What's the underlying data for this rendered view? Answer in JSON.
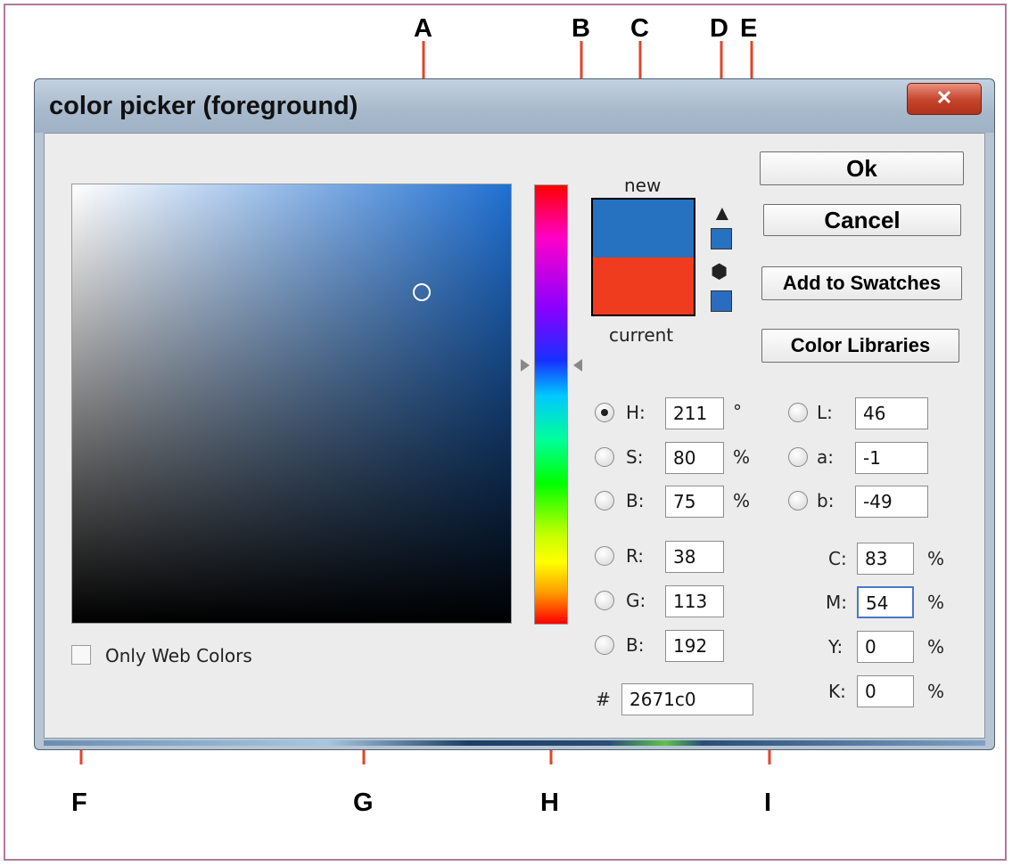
{
  "callouts": [
    "A",
    "B",
    "C",
    "D",
    "E",
    "F",
    "G",
    "H",
    "I"
  ],
  "dialog": {
    "title": "color picker (foreground)",
    "close_glyph": "✕"
  },
  "swatch": {
    "new_label": "new",
    "current_label": "current",
    "new_color": "#2671c0",
    "current_color": "#ef3c1e"
  },
  "buttons": {
    "ok": "Ok",
    "cancel": "Cancel",
    "add_to_swatches": "Add to Swatches",
    "color_libraries": "Color Libraries"
  },
  "hsb": [
    {
      "label": "H:",
      "value": "211",
      "unit": "°",
      "selected": true
    },
    {
      "label": "S:",
      "value": "80",
      "unit": "%",
      "selected": false
    },
    {
      "label": "B:",
      "value": "75",
      "unit": "%",
      "selected": false
    }
  ],
  "rgb": [
    {
      "label": "R:",
      "value": "38"
    },
    {
      "label": "G:",
      "value": "113"
    },
    {
      "label": "B:",
      "value": "192"
    }
  ],
  "lab": [
    {
      "label": "L:",
      "value": "46"
    },
    {
      "label": "a:",
      "value": "-1"
    },
    {
      "label": "b:",
      "value": "-49"
    }
  ],
  "cmyk": [
    {
      "label": "C:",
      "value": "83",
      "unit": "%"
    },
    {
      "label": "M:",
      "value": "54",
      "unit": "%"
    },
    {
      "label": "Y:",
      "value": "0",
      "unit": "%"
    },
    {
      "label": "K:",
      "value": "0",
      "unit": "%"
    }
  ],
  "hex": {
    "label": "#",
    "value": "2671c0"
  },
  "web_colors": {
    "label": "Only Web Colors",
    "checked": false
  },
  "icons": {
    "gamut_warning": "warning-triangle-icon",
    "web_safe_warning": "cube-icon"
  }
}
